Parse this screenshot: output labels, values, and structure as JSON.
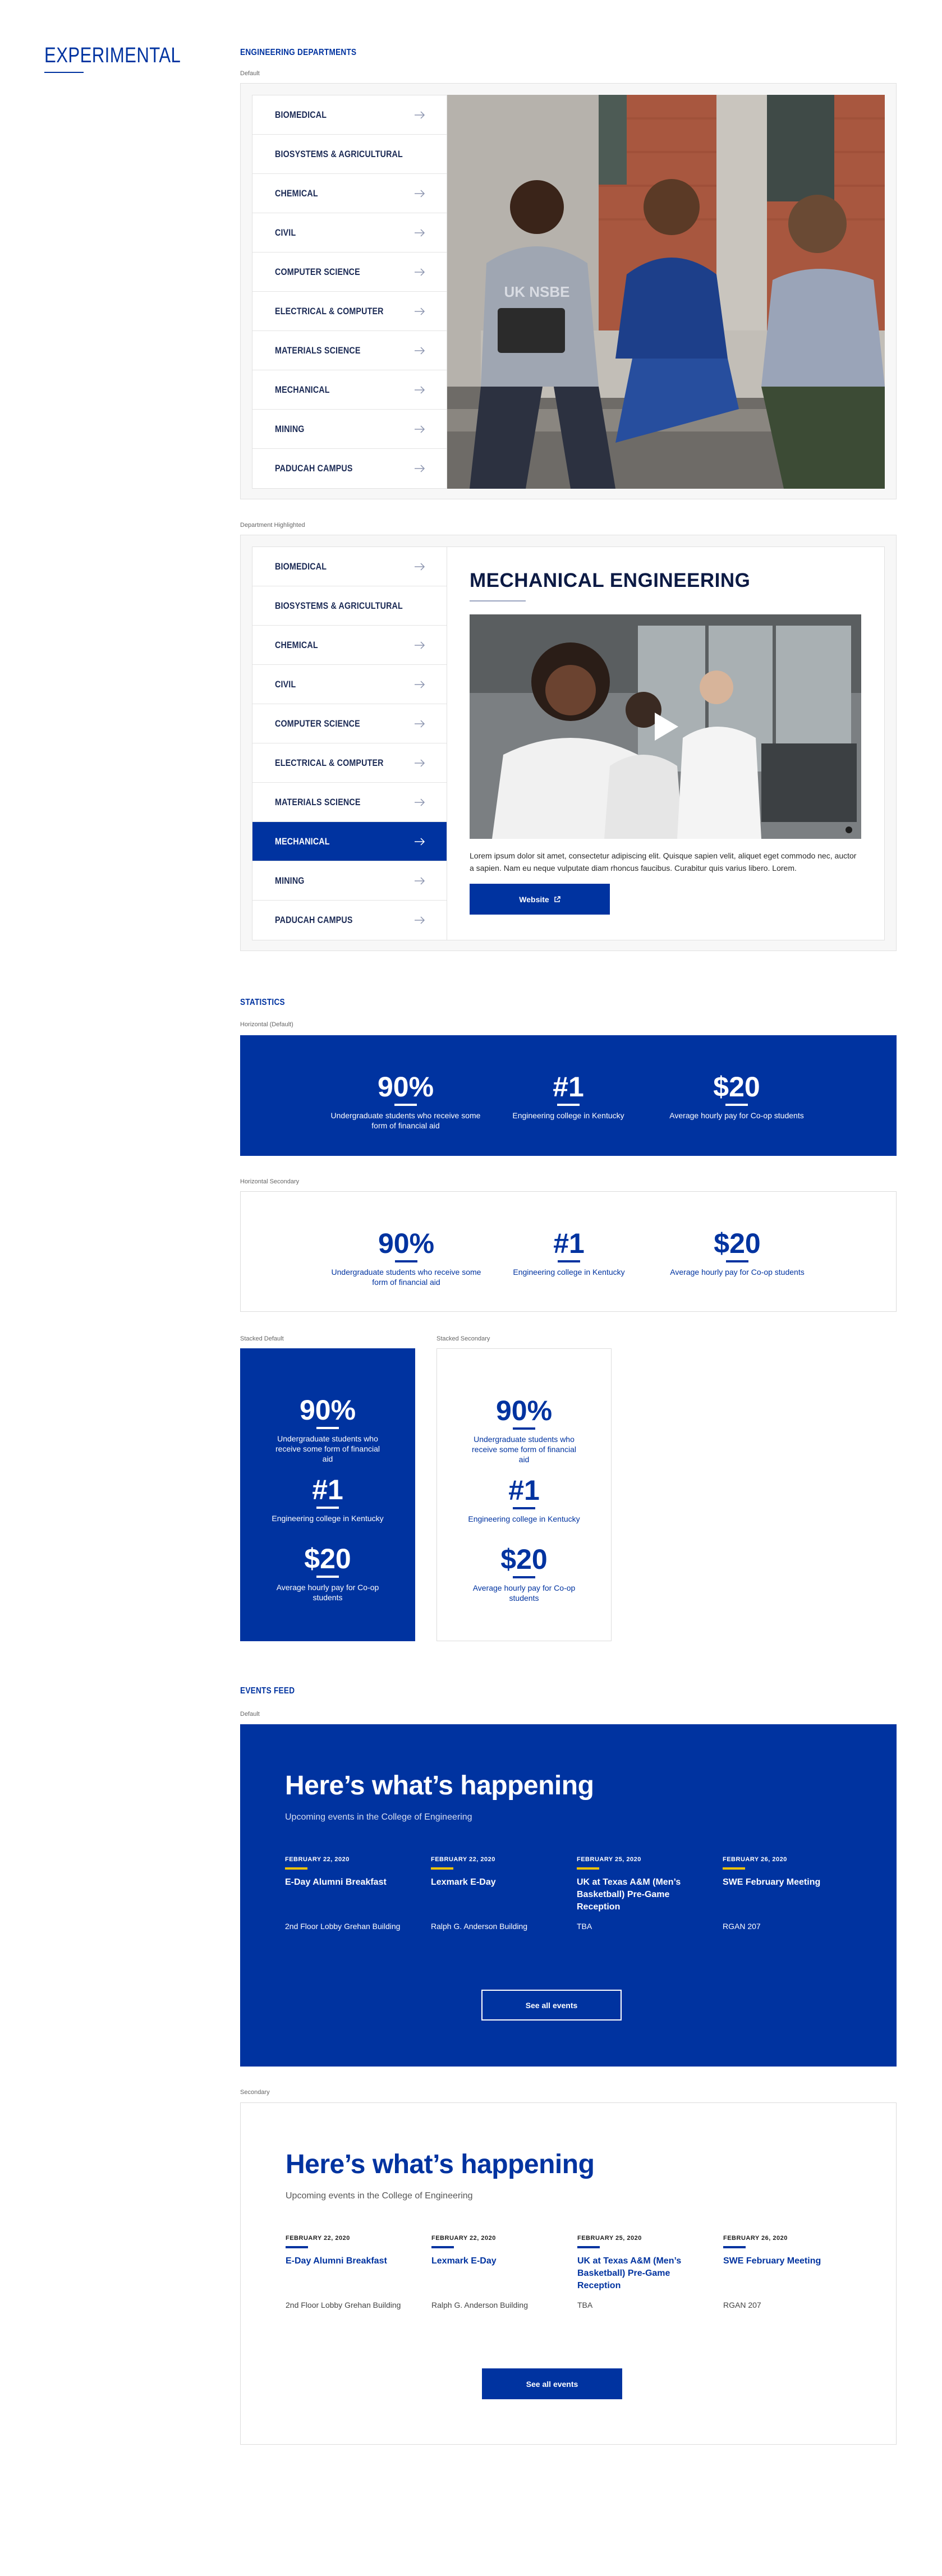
{
  "sidebar": {
    "title": "EXPERIMENTAL"
  },
  "departments": {
    "heading": "ENGINEERING DEPARTMENTS",
    "default_label": "Default",
    "highlighted_label": "Department Highlighted",
    "items": [
      "BIOMEDICAL",
      "BIOSYSTEMS & AGRICULTURAL",
      "CHEMICAL",
      "CIVIL",
      "COMPUTER SCIENCE",
      "ELECTRICAL & COMPUTER",
      "MATERIALS SCIENCE",
      "MECHANICAL",
      "MINING",
      "PADUCAH CAMPUS"
    ],
    "active_item": "MECHANICAL",
    "detail": {
      "title": "MECHANICAL ENGINEERING",
      "text": "Lorem ipsum dolor sit amet, consectetur adipiscing elit. Quisque sapien velit, aliquet eget commodo nec, auctor a sapien. Nam eu neque vulputate diam rhoncus faucibus. Curabitur quis varius libero. Lorem.",
      "button": "Website"
    },
    "photo_shirt_text": "UK NSBE"
  },
  "statistics": {
    "heading": "STATISTICS",
    "labels": {
      "horizontal_default": "Horizontal (Default)",
      "horizontal_secondary": "Horizontal Secondary",
      "stacked_default": "Stacked Default",
      "stacked_secondary": "Stacked Secondary"
    },
    "items": [
      {
        "value": "90%",
        "desc": "Undergraduate students who receive some form of financial aid"
      },
      {
        "value": "#1",
        "desc": "Engineering college in Kentucky"
      },
      {
        "value": "$20",
        "desc": "Average hourly pay for Co-op students"
      }
    ]
  },
  "events": {
    "heading": "EVENTS FEED",
    "default_label": "Default",
    "secondary_label": "Secondary",
    "title": "Here’s what’s happening",
    "subtitle": "Upcoming events in the College of Engineering",
    "button": "See all events",
    "items": [
      {
        "date": "FEBRUARY 22, 2020",
        "name": "E-Day Alumni Breakfast",
        "location": "2nd Floor Lobby Grehan Building"
      },
      {
        "date": "FEBRUARY 22, 2020",
        "name": "Lexmark E-Day",
        "location": "Ralph G. Anderson Building"
      },
      {
        "date": "FEBRUARY 25, 2020",
        "name": "UK at Texas A&M (Men’s Basketball) Pre-Game Reception",
        "location": "TBA"
      },
      {
        "date": "FEBRUARY 26, 2020",
        "name": "SWE February Meeting",
        "location": "RGAN 207"
      }
    ]
  },
  "colors": {
    "brand": "#0033a0",
    "accent": "#f2c300",
    "panel": "#f7f7f7"
  }
}
